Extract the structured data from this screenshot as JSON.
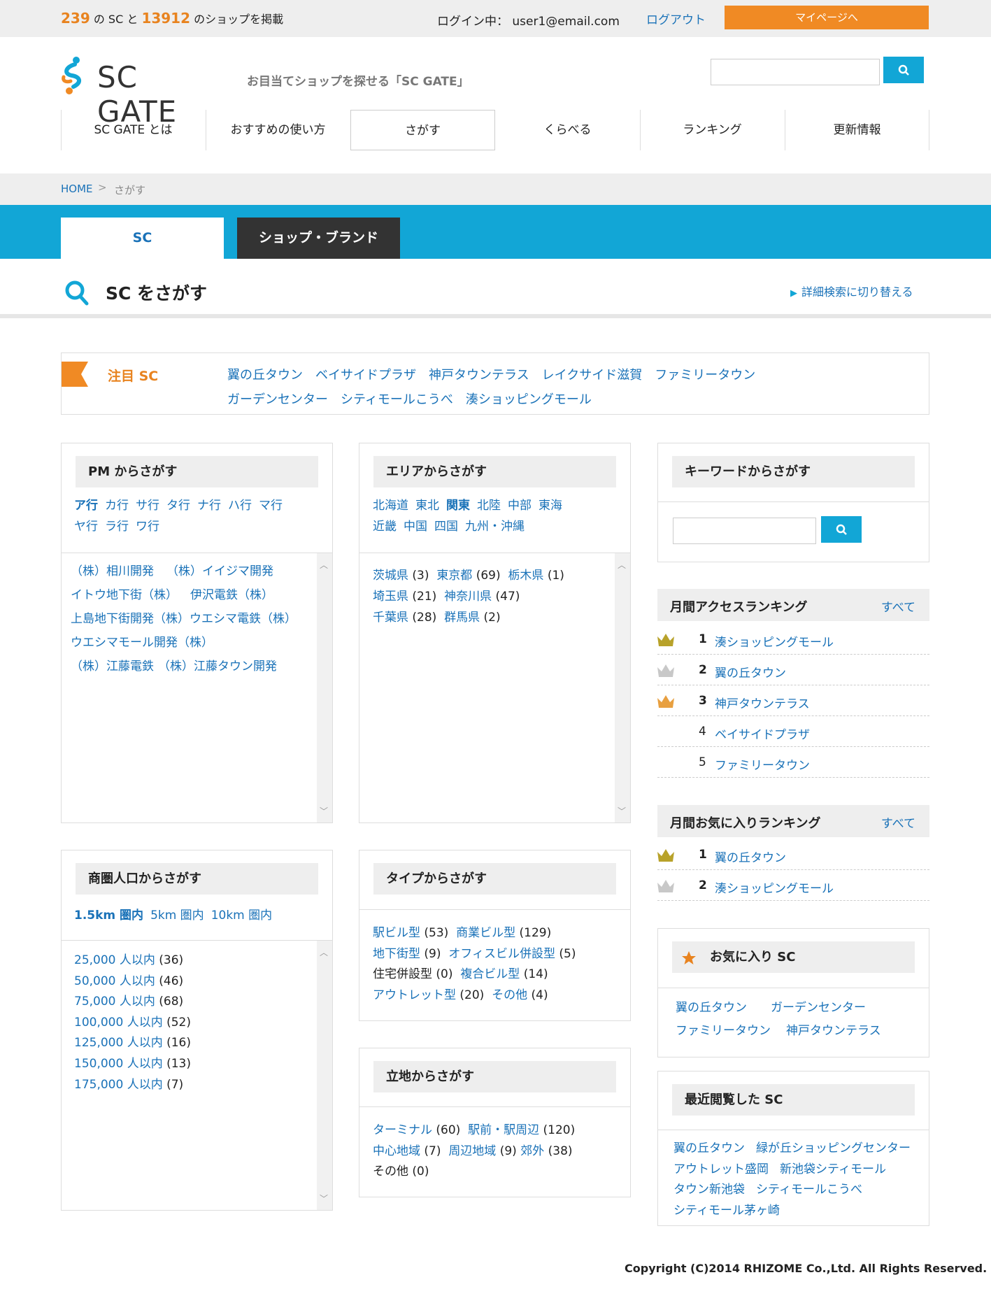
{
  "topbar": {
    "sc_count": "239",
    "sc_unit": " の SC と ",
    "shop_count": "13912",
    "shop_unit": " のショップを掲載",
    "login_text": "ログイン中： user1@email.com",
    "logout": "ログアウト",
    "mypage": "マイページへ"
  },
  "header": {
    "logo": "SC GATE",
    "tagline": "お目当てショップを探せる「SC GATE」",
    "search_placeholder": ""
  },
  "nav": [
    "SC GATE とは",
    "おすすめの使い方",
    "さがす",
    "くらべる",
    "ランキング",
    "更新情報"
  ],
  "breadcrumb": {
    "home": "HOME",
    "sep": ">",
    "current": "さがす"
  },
  "tabs": {
    "sc": "SC",
    "shop": "ショップ・ブランド"
  },
  "page": {
    "title": "SC をさがす",
    "switch": "詳細検索に切り替える"
  },
  "featured": {
    "label": "注目 SC",
    "items": [
      "翼の丘タウン",
      "ベイサイドプラザ",
      "神戸タウンテラス",
      "レイクサイド滋賀",
      "ファミリータウン",
      "ガーデンセンター",
      "シティモールこうべ",
      "湊ショッピングモール"
    ]
  },
  "pm": {
    "title": "PM からさがす",
    "kana": [
      "ア行",
      "カ行",
      "サ行",
      "タ行",
      "ナ行",
      "ハ行",
      "マ行",
      "ヤ行",
      "ラ行",
      "ワ行"
    ],
    "companies": [
      "（株）相川開発",
      "（株）イイジマ開発",
      "イトウ地下街（株）",
      "伊沢電鉄（株）",
      "上島地下街開発（株）",
      "ウエシマ電鉄（株）",
      "ウエシマモール開発（株）",
      "（株）江藤電鉄",
      "（株）江藤タウン開発"
    ]
  },
  "area": {
    "title": "エリアからさがす",
    "regions": [
      "北海道",
      "東北",
      "関東",
      "北陸",
      "中部",
      "東海",
      "近畿",
      "中国",
      "四国",
      "九州・沖縄"
    ],
    "prefs": [
      {
        "name": "茨城県",
        "count": "(3)"
      },
      {
        "name": "東京都",
        "count": "(69)"
      },
      {
        "name": "栃木県",
        "count": "(1)"
      },
      {
        "name": "埼玉県",
        "count": "(21)"
      },
      {
        "name": "神奈川県",
        "count": "(47)"
      },
      {
        "name": "千葉県",
        "count": "(28)"
      },
      {
        "name": "群馬県",
        "count": "(2)"
      }
    ]
  },
  "keyword": {
    "title": "キーワードからさがす",
    "placeholder": ""
  },
  "access_rank": {
    "title": "月間アクセスランキング",
    "all": "すべて",
    "items": [
      {
        "rank": "1",
        "name": "湊ショッピングモール"
      },
      {
        "rank": "2",
        "name": "翼の丘タウン"
      },
      {
        "rank": "3",
        "name": "神戸タウンテラス"
      },
      {
        "rank": "4",
        "name": "ベイサイドプラザ"
      },
      {
        "rank": "5",
        "name": "ファミリータウン"
      }
    ]
  },
  "fav_rank": {
    "title": "月間お気に入りランキング",
    "all": "すべて",
    "items": [
      {
        "rank": "1",
        "name": "翼の丘タウン"
      },
      {
        "rank": "2",
        "name": "湊ショッピングモール"
      }
    ]
  },
  "population": {
    "title": "商圏人口からさがす",
    "ranges": [
      "1.5km 圏内",
      "5km 圏内",
      "10km 圏内"
    ],
    "items": [
      {
        "name": "25,000 人以内",
        "count": "(36)"
      },
      {
        "name": "50,000 人以内",
        "count": "(46)"
      },
      {
        "name": "75,000 人以内",
        "count": "(68)"
      },
      {
        "name": "100,000 人以内",
        "count": "(52)"
      },
      {
        "name": "125,000 人以内",
        "count": "(16)"
      },
      {
        "name": "150,000 人以内",
        "count": "(13)"
      },
      {
        "name": "175,000 人以内",
        "count": "(7)"
      }
    ]
  },
  "type": {
    "title": "タイプからさがす",
    "items": [
      {
        "name": "駅ビル型",
        "count": "(53)"
      },
      {
        "name": "商業ビル型",
        "count": "(129)"
      },
      {
        "name": "地下街型",
        "count": "(9)"
      },
      {
        "name": "オフィスビル併設型",
        "count": "(5)"
      },
      {
        "name": "住宅併設型",
        "count": "(0)"
      },
      {
        "name": "複合ビル型",
        "count": "(14)"
      },
      {
        "name": "アウトレット型",
        "count": "(20)"
      },
      {
        "name": "その他",
        "count": "(4)"
      }
    ]
  },
  "location": {
    "title": "立地からさがす",
    "items": [
      {
        "name": "ターミナル",
        "count": "(60)"
      },
      {
        "name": "駅前・駅周辺",
        "count": "(120)"
      },
      {
        "name": "中心地域",
        "count": "(7)"
      },
      {
        "name": "周辺地域",
        "count": "(9)"
      },
      {
        "name": "郊外",
        "count": "(38)"
      },
      {
        "name": "その他",
        "count": "(0)"
      }
    ]
  },
  "fav_sc": {
    "title": "お気に入り SC",
    "items": [
      "翼の丘タウン",
      "ガーデンセンター",
      "ファミリータウン",
      "神戸タウンテラス"
    ]
  },
  "recent_sc": {
    "title": "最近閲覧した SC",
    "items": [
      "翼の丘タウン",
      "緑が丘ショッピングセンター",
      "アウトレット盛岡",
      "新池袋シティモール",
      "タウン新池袋",
      "シティモールこうべ",
      "シティモール茅ヶ崎"
    ]
  },
  "footer": {
    "copyright": "Copyright (C)2014 RHIZOME Co.,Ltd. All Rights Reserved."
  },
  "colors": {
    "accent_blue": "#12a6d6",
    "orange": "#f08a24",
    "link": "#1a72b8",
    "gold_crown": "#b8a22a",
    "silver_crown": "#c8c8c8",
    "bronze_crown": "#e8a040"
  }
}
